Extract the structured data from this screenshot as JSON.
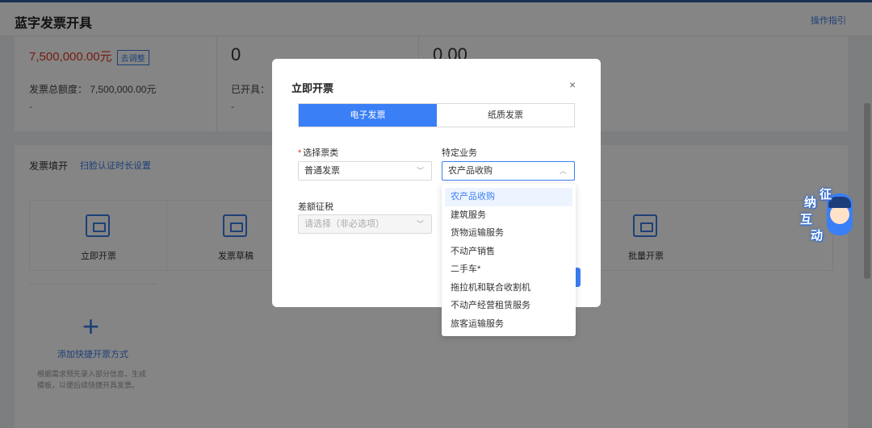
{
  "header": {
    "title": "蓝字发票开具",
    "help": "操作指引"
  },
  "stats": {
    "amount": "7,500,000.00元",
    "adjust": "去调整",
    "total_label": "发票总额度：",
    "total_value": "7,500,000.00元",
    "dash1": "-",
    "count": "0",
    "issued_label": "已开具：",
    "dash2": "-",
    "third": "0.00"
  },
  "fill": {
    "title": "发票填开",
    "link": "扫脸认证时长设置",
    "tiles": [
      "立即开票",
      "发票草稿",
      "批量开票"
    ],
    "add_label": "添加快捷开票方式",
    "add_desc": "根据需求预先录入部分信息，生成模板，以便后续快捷开具发票。"
  },
  "modal": {
    "title": "立即开票",
    "close": "×",
    "tab_electronic": "电子发票",
    "tab_paper": "纸质发票",
    "invoice_type_required": "*",
    "invoice_type_label": "选择票类",
    "invoice_type_value": "普通发票",
    "special_label": "特定业务",
    "special_value": "农产品收购",
    "diff_label": "差额征税",
    "diff_placeholder": "请选择（非必选项）"
  },
  "dropdown": {
    "options": [
      "农产品收购",
      "建筑服务",
      "货物运输服务",
      "不动产销售",
      "二手车*",
      "拖拉机和联合收割机",
      "不动产经营租赁服务",
      "旅客运输服务"
    ]
  },
  "badge": {
    "chars": [
      "征",
      "纳",
      "互",
      "动"
    ]
  },
  "colors": {
    "accent": "#3a7ff5",
    "amount_red": "#e0391f"
  }
}
